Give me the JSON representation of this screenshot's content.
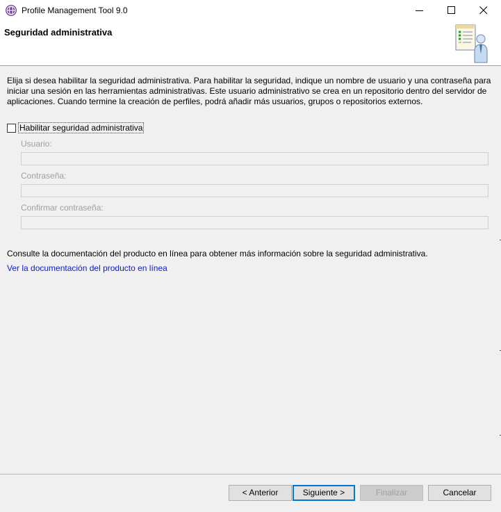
{
  "window": {
    "title": "Profile Management Tool 9.0",
    "controls": [
      "minimize-icon",
      "maximize-icon",
      "close-icon"
    ]
  },
  "header": {
    "title": "Seguridad administrativa",
    "icon": "wizard-user-icon"
  },
  "main": {
    "description": "Elija si desea habilitar la seguridad administrativa. Para habilitar la seguridad, indique un nombre de usuario y una contraseña para iniciar una sesión en las herramientas administrativas. Este usuario administrativo se crea en un repositorio dentro del servidor de aplicaciones. Cuando termine la creación de perfiles, podrá añadir más usuarios, grupos o repositorios externos.",
    "enable_security": {
      "label": "Habilitar seguridad administrativa",
      "checked": false
    },
    "fields": {
      "username": {
        "label": "Usuario:",
        "value": ""
      },
      "password": {
        "label": "Contraseña:",
        "value": ""
      },
      "confirm_password": {
        "label": "Confirmar contraseña:",
        "value": ""
      }
    },
    "info_text": "Consulte la documentación del producto en línea para obtener más información sobre la seguridad administrativa.",
    "doc_link": "Ver la documentación del producto en línea"
  },
  "buttons": {
    "back": "< Anterior",
    "next": "Siguiente >",
    "finish": "Finalizar",
    "cancel": "Cancelar"
  },
  "colors": {
    "link": "#0a1bd6",
    "accent": "#0078d7",
    "disabled_text": "#a0a0a0",
    "background": "#f0f0f0"
  }
}
